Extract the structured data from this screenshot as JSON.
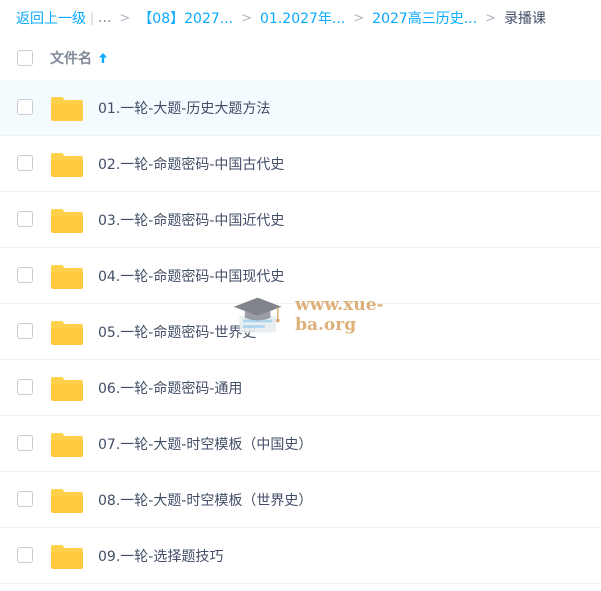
{
  "breadcrumb": {
    "back_label": "返回上一级",
    "pipe": "|",
    "ellipsis": "...",
    "separator": ">",
    "items": [
      {
        "label": "【08】2027..."
      },
      {
        "label": "01.2027年..."
      },
      {
        "label": "2027高三历史..."
      }
    ],
    "current": "录播课"
  },
  "header": {
    "column_label": "文件名",
    "sort_icon": "arrow-up-icon"
  },
  "files": [
    {
      "name": "01.一轮-大题-历史大题方法",
      "icon": "folder-icon"
    },
    {
      "name": "02.一轮-命题密码-中国古代史",
      "icon": "folder-icon"
    },
    {
      "name": "03.一轮-命题密码-中国近代史",
      "icon": "folder-icon"
    },
    {
      "name": "04.一轮-命题密码-中国现代史",
      "icon": "folder-icon"
    },
    {
      "name": "05.一轮-命题密码-世界史",
      "icon": "folder-icon"
    },
    {
      "name": "06.一轮-命题密码-通用",
      "icon": "folder-icon"
    },
    {
      "name": "07.一轮-大题-时空模板（中国史）",
      "icon": "folder-icon"
    },
    {
      "name": "08.一轮-大题-时空模板（世界史）",
      "icon": "folder-icon"
    },
    {
      "name": "09.一轮-选择题技巧",
      "icon": "folder-icon"
    }
  ],
  "watermark": {
    "text": "www.xue-ba.org",
    "icon": "graduation-cap-icon"
  },
  "colors": {
    "accent": "#09aaff",
    "folder": "#ffd04b",
    "hover_row": "#f4fbff",
    "text": "#424e67"
  }
}
